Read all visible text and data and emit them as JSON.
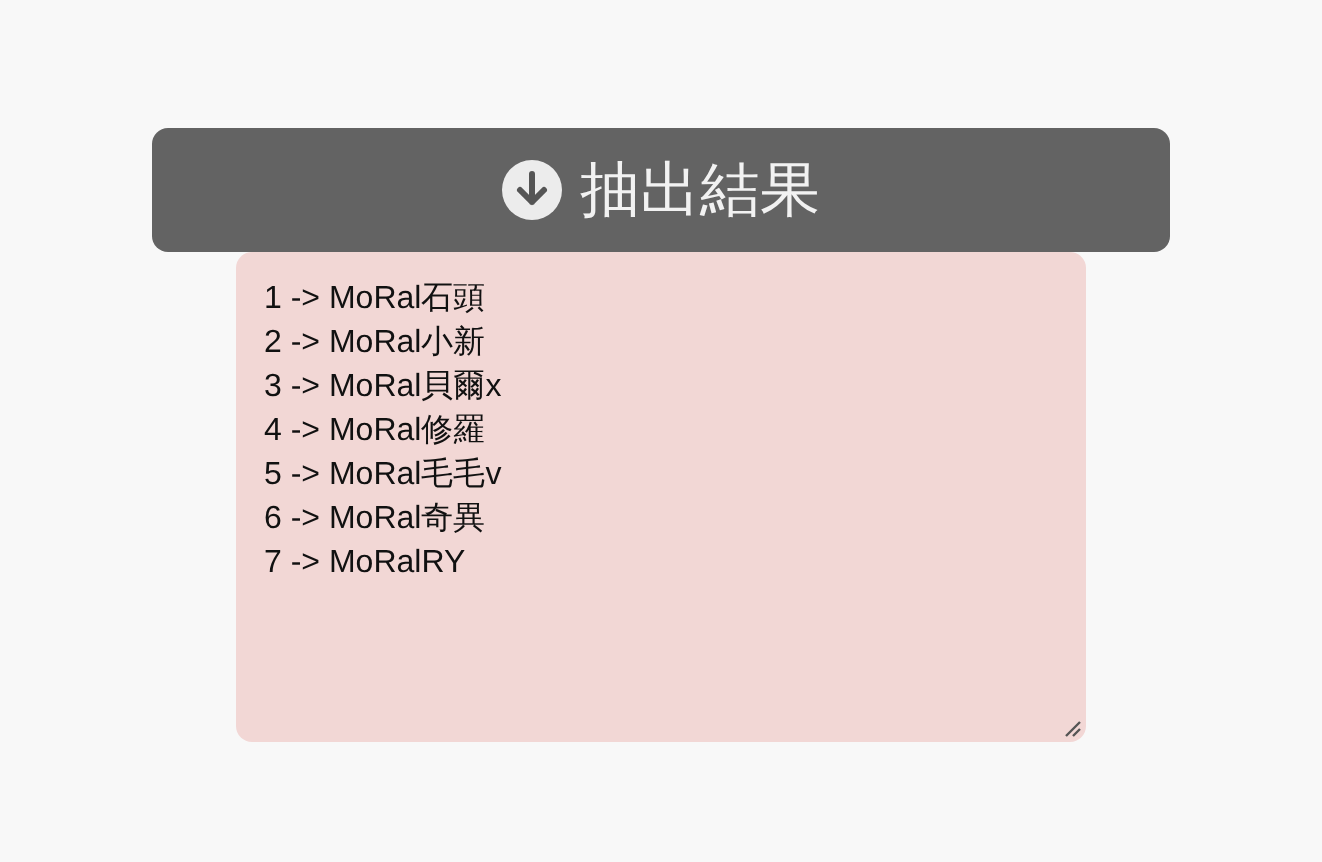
{
  "button": {
    "label": "抽出結果"
  },
  "result": {
    "lines": [
      "1 -> MoRal石頭",
      "2 -> MoRal小新",
      "3 -> MoRal貝爾x",
      "4 -> MoRal修羅",
      "5 -> MoRal毛毛v",
      "6 -> MoRal奇異",
      "7 -> MoRalRY"
    ]
  }
}
